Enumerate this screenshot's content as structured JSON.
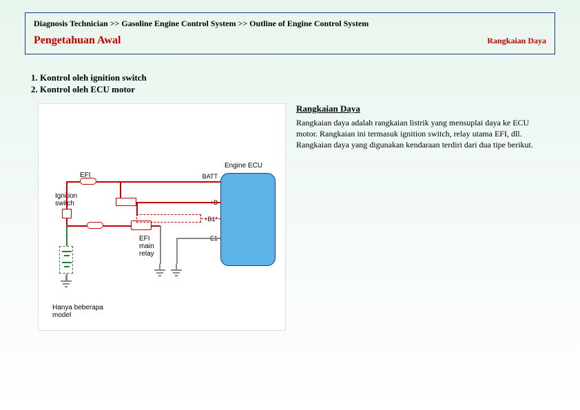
{
  "header": {
    "breadcrumb": "Diagnosis Technician >> Gasoline Engine Control System >> Outline of Engine Control System",
    "title_left": "Pengetahuan Awal",
    "title_right": "Rangkaian Daya"
  },
  "list": {
    "item1": "1. Kontrol oleh ignition switch",
    "item2": "2. Kontrol oleh ECU motor"
  },
  "desc": {
    "title": "Rangkaian Daya",
    "text": "Rangkaian daya adalah rangkaian listrik yang mensuplai daya ke ECU motor. Rangkaian ini termasuk ignition switch, relay utama EFI, dll. Rangkaian daya yang digunakan kendaraan terdiri dari dua tipe berikut."
  },
  "diagram": {
    "ecu_title": "Engine ECU",
    "label_efi": "EFI",
    "label_ignition": "Ignition\nswitch",
    "label_relay": "EFI\nmain\nrelay",
    "pin_batt": "BATT",
    "pin_b": "+B",
    "pin_b1": "+B1*",
    "pin_e1": "E1",
    "note": "Hanya beberapa model"
  }
}
